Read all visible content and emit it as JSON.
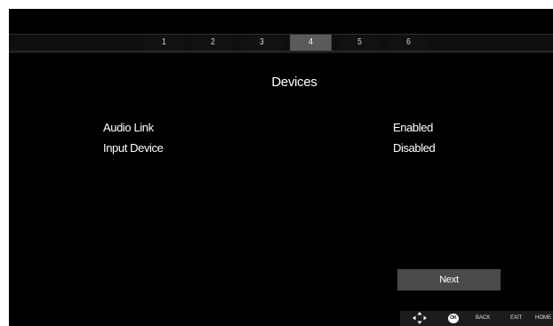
{
  "steps": {
    "items": [
      "1",
      "2",
      "3",
      "4",
      "5",
      "6"
    ],
    "active_index": 3
  },
  "page": {
    "title": "Devices"
  },
  "settings": [
    {
      "label": "Audio Link",
      "value": "Enabled"
    },
    {
      "label": "Input Device",
      "value": "Disabled"
    }
  ],
  "buttons": {
    "next_label": "Next"
  },
  "help_bar": {
    "nav_icon": "navigation-arrows-icon",
    "ok_label": "OK",
    "back_label": "BACK",
    "exit_label": "EXIT",
    "home_label": "HOME"
  },
  "colors": {
    "background": "#000000",
    "step_active": "#5a5a5a",
    "button_bg": "#4a4a4a",
    "text": "#ffffff"
  }
}
